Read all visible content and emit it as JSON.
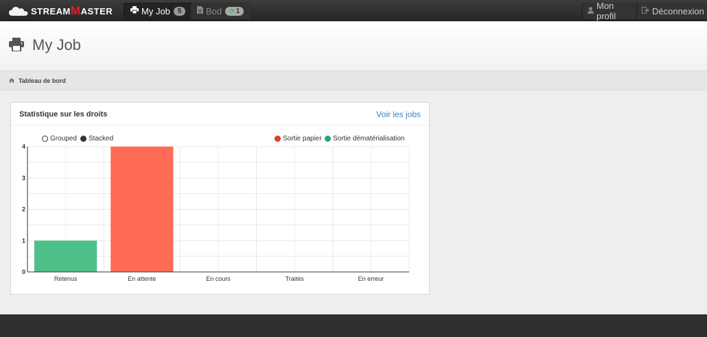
{
  "brand": {
    "name_prefix": "S",
    "name_first": "TREAM",
    "name_m": "M",
    "name_rest": "ASTER"
  },
  "nav": {
    "tabs": [
      {
        "label": "My Job",
        "badge": "5",
        "icon": "print-icon"
      },
      {
        "label": "Bod",
        "badge": "1",
        "icon": "document-icon"
      }
    ],
    "right": [
      {
        "label": "Mon profil",
        "icon": "user-icon"
      },
      {
        "label": "Déconnexion",
        "icon": "logout-icon"
      }
    ]
  },
  "page": {
    "title": "My Job",
    "icon": "print-icon"
  },
  "breadcrumb": {
    "items": [
      "Tableau de bord"
    ],
    "icon": "home-icon"
  },
  "panel": {
    "title": "Statistique sur les droits",
    "link": "Voir les jobs",
    "controls": {
      "grouped": "Grouped",
      "stacked": "Stacked"
    }
  },
  "colors": {
    "paper": "#ff6b57",
    "digital": "#4fbf8a",
    "navbar": "#2b2b2b",
    "link": "#3a7fc1"
  },
  "chart_data": {
    "type": "bar",
    "categories": [
      "Retenus",
      "En attente",
      "En cours",
      "Traités",
      "En erreur"
    ],
    "series": [
      {
        "name": "Sortie papier",
        "values": [
          0,
          4,
          0,
          0,
          0
        ]
      },
      {
        "name": "Sortie dématérialisation",
        "values": [
          1,
          0,
          0,
          0,
          0
        ]
      }
    ],
    "mode": "stacked",
    "ylim": [
      0,
      4
    ],
    "yticks": [
      "0",
      "1",
      "2",
      "3",
      "4"
    ],
    "grid": true,
    "legend": "top-right"
  }
}
